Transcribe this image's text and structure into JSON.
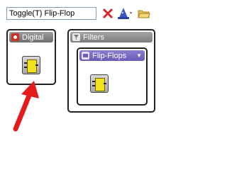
{
  "toolbar": {
    "search": {
      "value": "Toggle(T) Flip-Flop",
      "placeholder": ""
    },
    "icons": [
      "clear-x-icon",
      "wizard-hat-icon",
      "folder-open-icon"
    ]
  },
  "libraries": {
    "digital": {
      "label": "Digital",
      "icon": "digital-library-icon",
      "item_icon": "logic-chip-icon"
    },
    "filters": {
      "label": "Filters",
      "icon": "filters-library-icon"
    },
    "flipflops": {
      "label": "Flip-Flops",
      "icon": "flipflops-library-icon",
      "item_icon": "flip-flop-chip-icon"
    }
  },
  "annotation": {
    "arrow_color": "#e31b1b",
    "points_to": "logic-chip-icon"
  },
  "colors": {
    "digital_header": "#808080",
    "filters_header": "#8a8a8a",
    "flipflops_header": "#7a6ac6",
    "chip_yellow": "#f3e11c"
  }
}
